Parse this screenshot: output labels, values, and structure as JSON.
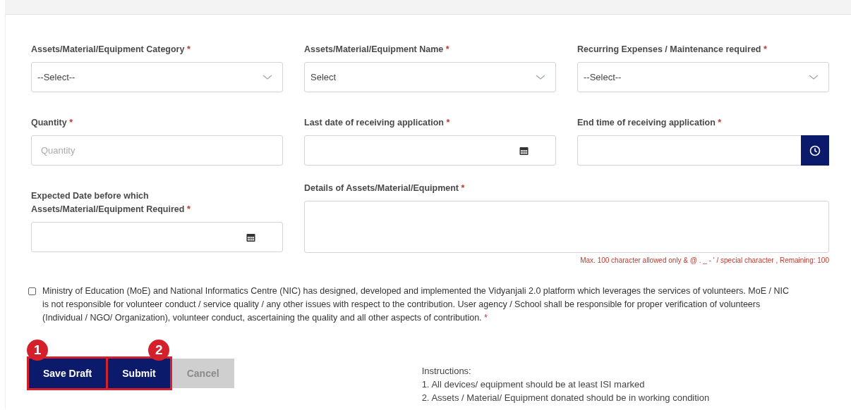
{
  "fields": [
    {
      "kind": "select",
      "label": "Assets/Material/Equipment Category",
      "required_mark": "*",
      "value": "--Select--"
    },
    {
      "kind": "select",
      "label": "Assets/Material/Equipment Name",
      "required_mark": "*",
      "value": "Select"
    },
    {
      "kind": "select",
      "label": "Recurring Expenses / Maintenance required",
      "required_mark": "*",
      "value": "--Select--"
    },
    {
      "kind": "text",
      "label": "Quantity",
      "required_mark": "*",
      "placeholder": "Quantity"
    },
    {
      "kind": "date",
      "label": "Last date of receiving application",
      "required_mark": "*"
    },
    {
      "kind": "time",
      "label": "End time of receiving application",
      "required_mark": "*"
    },
    {
      "kind": "date",
      "label": "Expected Date before which Assets/Material/Equipment Required",
      "required_mark": "*"
    },
    {
      "kind": "textarea",
      "label": "Details of Assets/Material/Equipment",
      "required_mark": "*",
      "hint": "Max. 100 character allowed only & @ . _ - ' / special character , Remaining: 100"
    }
  ],
  "disclaimer": {
    "checked": false,
    "required_mark": "*",
    "text": "Ministry of Education (MoE) and National Informatics Centre (NIC) has designed, developed and implemented the Vidyanjali 2.0 platform which leverages the services of volunteers. MoE / NIC is not responsible for volunteer conduct / service quality / any other issues with respect to the contribution. User agency / School shall be responsible for proper verification of volunteers (Individual / NGO/ Organization), volunteer conduct, ascertaining the quality and all other aspects of contribution."
  },
  "buttons": [
    {
      "label": "Save Draft",
      "disabled": false,
      "highlighted": true,
      "callout": "1"
    },
    {
      "label": "Submit",
      "disabled": false,
      "highlighted": true,
      "callout": "2"
    },
    {
      "label": "Cancel",
      "disabled": true,
      "highlighted": false
    }
  ],
  "instructions": {
    "title": "Instructions:",
    "items": [
      "1. All devices/ equipment should be at least ISI marked",
      "2. Assets / Material/ Equipment donated should be in working condition"
    ]
  }
}
